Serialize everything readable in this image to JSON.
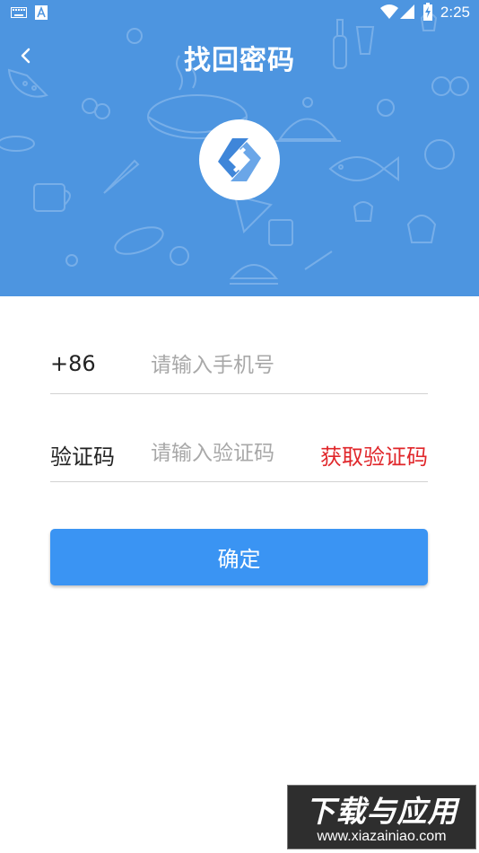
{
  "status_bar": {
    "time": "2:25",
    "icons": [
      "keyboard-icon",
      "a-notification-icon",
      "wifi-icon",
      "signal-icon",
      "battery-charging-icon"
    ]
  },
  "header": {
    "title": "找回密码",
    "back_icon": "chevron-left-icon",
    "background_color": "#4d95e0"
  },
  "form": {
    "phone": {
      "prefix": "+86",
      "placeholder": "请输入手机号",
      "value": ""
    },
    "code": {
      "label": "验证码",
      "placeholder": "请输入验证码",
      "value": "",
      "get_code_label": "获取验证码"
    },
    "confirm_label": "确定"
  },
  "colors": {
    "accent": "#3a94f3",
    "get_code_text": "#e0262a"
  },
  "watermark": {
    "line1": "下载与应用",
    "line2": "www.xiazainiao.com"
  }
}
